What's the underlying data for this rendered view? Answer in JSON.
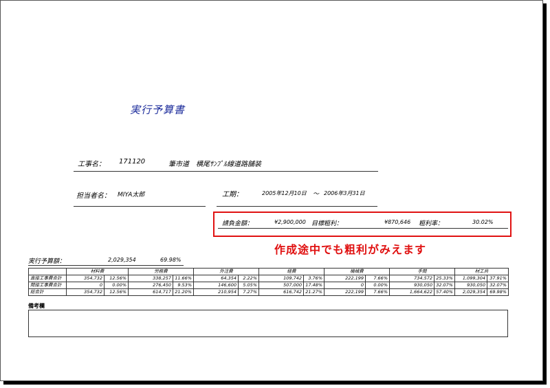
{
  "document": {
    "title": "実行予算書",
    "project_label": "工事名：",
    "project_code": "171120",
    "project_name": "筆市道　横尾ｻﾝﾌﾟﾙ線道路舗装",
    "person_label": "担当者名：",
    "person_name": "MIYA太郎",
    "period_label": "工期：",
    "period_start": "2005年12月10日",
    "period_sep": "～",
    "period_end": "2006年3月31日",
    "contract_label": "請負金額：",
    "contract_amount": "¥2,900,000",
    "target_profit_label": "目標粗利：",
    "target_profit_amount": "¥870,646",
    "profit_rate_label": "粗利率：",
    "profit_rate_value": "30.02%",
    "budget_label": "実行予算額：",
    "budget_amount": "2,029,354",
    "budget_rate": "69.98%",
    "remarks_label": "備考欄"
  },
  "annotation": {
    "callout_text": "作成途中でも粗利がみえます",
    "color": "#e01010"
  },
  "table": {
    "headers": [
      "材料費",
      "労務費",
      "外注費",
      "経費",
      "機械費",
      "手間",
      "材工共"
    ],
    "rows": [
      {
        "label": "直接工事費合計",
        "cells": [
          "354,732",
          "12.56%",
          "338,257",
          "11.66%",
          "64,354",
          "2.22%",
          "109,742",
          "3.76%",
          "222,199",
          "7.66%",
          "734,572",
          "25.33%",
          "1,099,304",
          "37.91%"
        ]
      },
      {
        "label": "間接工事費合計",
        "cells": [
          "0",
          "0.00%",
          "276,450",
          "9.53%",
          "146,600",
          "5.05%",
          "507,000",
          "17.48%",
          "0",
          "0.00%",
          "930,050",
          "32.07%",
          "930,050",
          "32.07%"
        ]
      },
      {
        "label": "総合計",
        "cells": [
          "354,732",
          "12.56%",
          "614,717",
          "21.20%",
          "210,954",
          "7.27%",
          "616,742",
          "21.27%",
          "222,199",
          "7.66%",
          "1,664,622",
          "57.40%",
          "2,029,354",
          "69.98%"
        ]
      }
    ]
  }
}
